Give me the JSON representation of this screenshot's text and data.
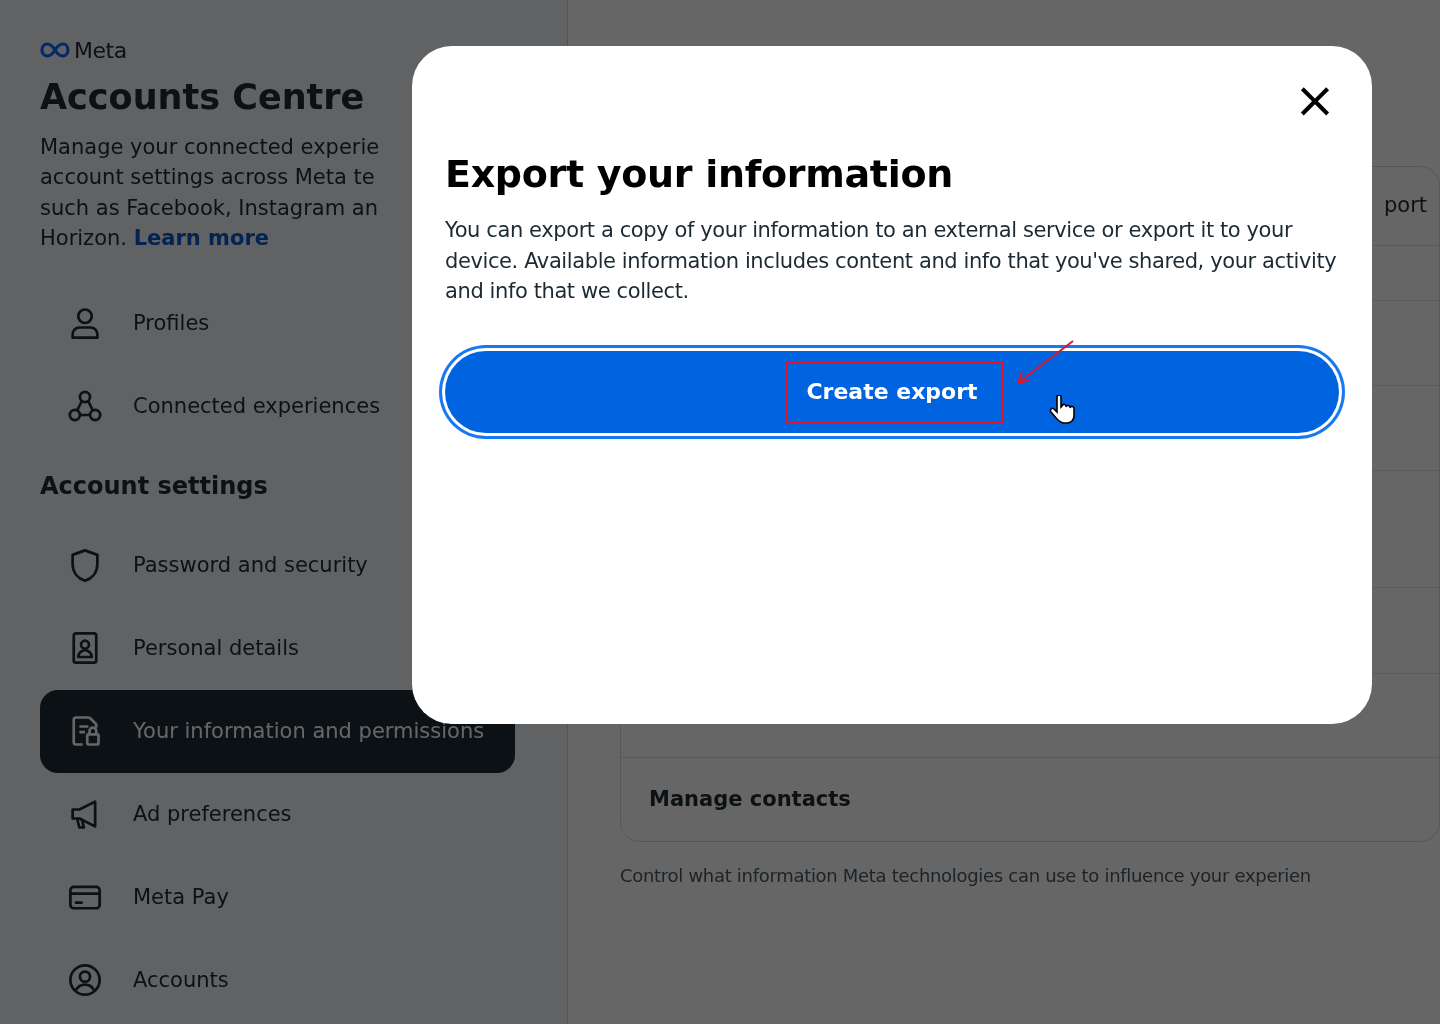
{
  "sidebar": {
    "logo": "Meta",
    "title": "Accounts Centre",
    "description_lines": [
      "Manage your connected experie",
      "account settings across Meta te",
      "such as Facebook, Instagram an",
      "Horizon."
    ],
    "learn_more": "Learn more",
    "top_items": [
      {
        "label": "Profiles",
        "selected": false
      },
      {
        "label": "Connected experiences",
        "selected": false
      }
    ],
    "section_heading": "Account settings",
    "items": [
      {
        "label": "Password and security",
        "selected": false
      },
      {
        "label": "Personal details",
        "selected": false
      },
      {
        "label": "Your information and permissions",
        "selected": true
      },
      {
        "label": "Ad preferences",
        "selected": false
      },
      {
        "label": "Meta Pay",
        "selected": false
      },
      {
        "label": "Accounts",
        "selected": false
      }
    ]
  },
  "content": {
    "row_text": "port",
    "card_row": "Manage contacts",
    "footnote": "Control what information Meta technologies can use to influence your experien"
  },
  "dialog": {
    "close": "×",
    "title": "Export your information",
    "body": "You can export a copy of your information to an external service or export it to your device. Available information includes content and info that you've shared, your activity and info that we collect.",
    "button": "Create export"
  }
}
